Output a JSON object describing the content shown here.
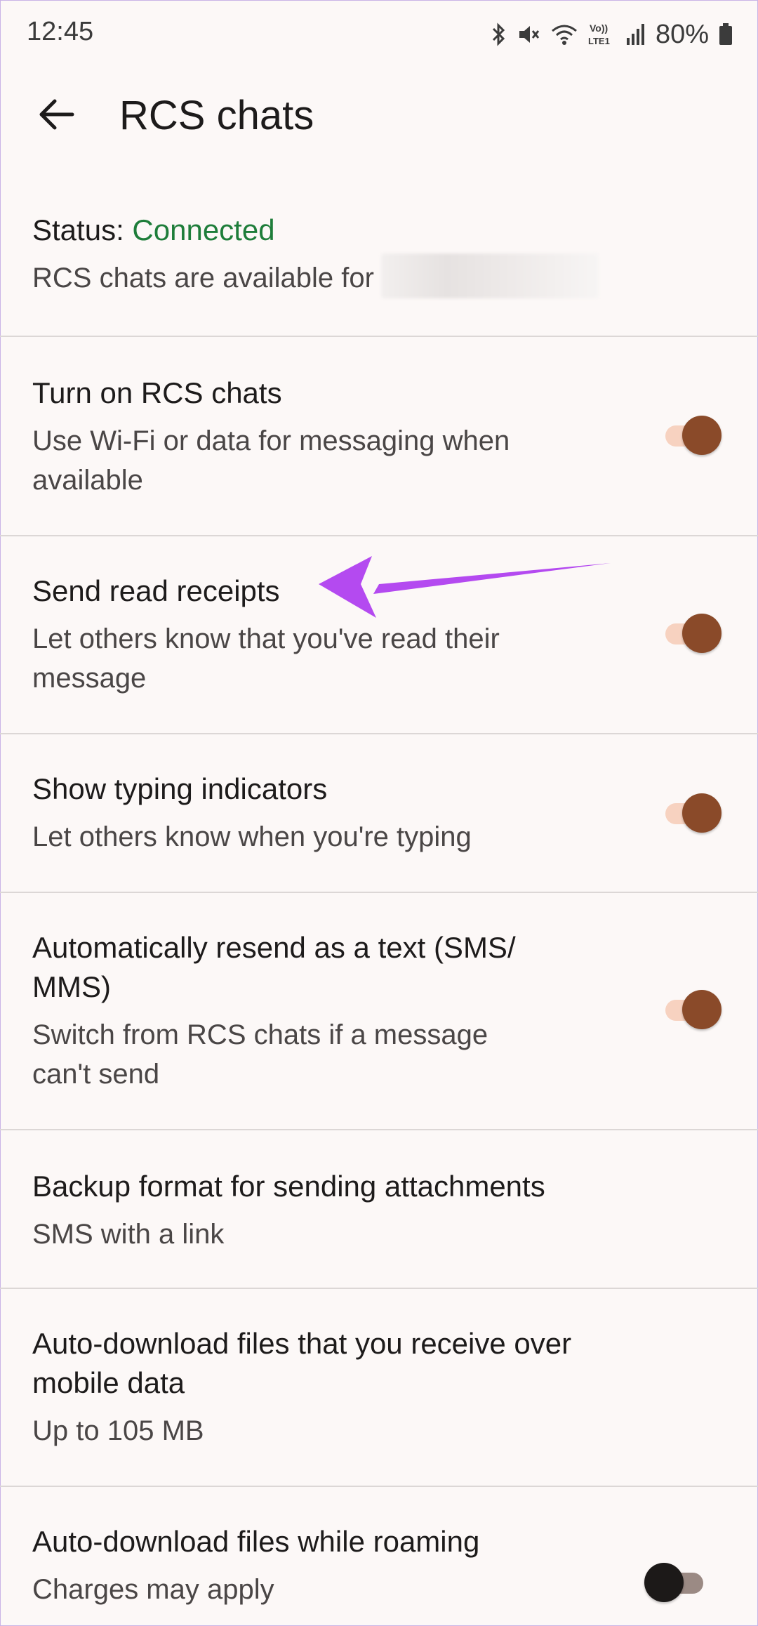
{
  "status_bar": {
    "time": "12:45",
    "battery": "80%",
    "icons": [
      "bluetooth-icon",
      "mute-icon",
      "wifi-icon",
      "volte-icon",
      "signal-icon",
      "battery-icon"
    ]
  },
  "header": {
    "title": "RCS chats"
  },
  "status_section": {
    "label": "Status: ",
    "value": "Connected",
    "value_color": "#1e7d3a",
    "description": "RCS chats are available for"
  },
  "settings": [
    {
      "title": "Turn on RCS chats",
      "sub_line1": "Use Wi-Fi or data for messaging when",
      "sub_line2": "available",
      "toggle_on": true
    },
    {
      "title": "Send read receipts",
      "sub_line1": "Let others know that you've read their",
      "sub_line2": "message",
      "toggle_on": true
    },
    {
      "title": "Show typing indicators",
      "sub_line1": "Let others know when you're typing",
      "toggle_on": true
    },
    {
      "title_line1": "Automatically resend as a text (SMS/",
      "title_line2": "MMS)",
      "sub_line1": "Switch from RCS chats if a message",
      "sub_line2": "can't send",
      "toggle_on": true
    },
    {
      "title": "Backup format for sending attachments",
      "sub_line1": "SMS with a link"
    },
    {
      "title_line1": "Auto-download files that you receive over",
      "title_line2": "mobile data",
      "sub_line1": "Up to 105 MB"
    },
    {
      "title": "Auto-download files while roaming",
      "sub_line1": "Charges may apply",
      "toggle_on": false
    }
  ],
  "colors": {
    "toggle_on_thumb": "#8a4a29",
    "toggle_on_track": "#f7d2c0",
    "annotation_arrow": "#b44af0"
  }
}
